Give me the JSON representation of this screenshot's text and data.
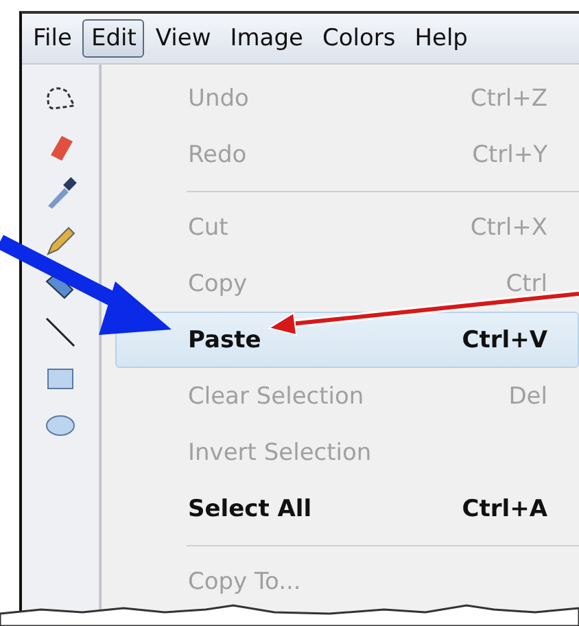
{
  "menu_bar": [
    {
      "label": "File",
      "selected": false
    },
    {
      "label": "Edit",
      "selected": true
    },
    {
      "label": "View",
      "selected": false
    },
    {
      "label": "Image",
      "selected": false
    },
    {
      "label": "Colors",
      "selected": false
    },
    {
      "label": "Help",
      "selected": false
    }
  ],
  "tools": [
    {
      "kind": "lasso"
    },
    {
      "kind": "eraser"
    },
    {
      "kind": "picker"
    },
    {
      "kind": "pencil"
    },
    {
      "kind": "fill"
    },
    {
      "kind": "line"
    },
    {
      "kind": "rect"
    },
    {
      "kind": "ellipse"
    }
  ],
  "edit_menu": [
    {
      "kind": "item",
      "label": "Undo",
      "shortcut": "Ctrl+Z",
      "disabled": true,
      "highlighted": false
    },
    {
      "kind": "item",
      "label": "Redo",
      "shortcut": "Ctrl+Y",
      "disabled": true,
      "highlighted": false
    },
    {
      "kind": "separator"
    },
    {
      "kind": "item",
      "label": "Cut",
      "shortcut": "Ctrl+X",
      "disabled": true,
      "highlighted": false
    },
    {
      "kind": "item",
      "label": "Copy",
      "shortcut": "Ctrl",
      "disabled": true,
      "highlighted": false
    },
    {
      "kind": "item",
      "label": "Paste",
      "shortcut": "Ctrl+V",
      "disabled": false,
      "highlighted": true
    },
    {
      "kind": "item",
      "label": "Clear Selection",
      "shortcut": "Del",
      "disabled": true,
      "highlighted": false
    },
    {
      "kind": "item",
      "label": "Invert Selection",
      "disabled": true,
      "highlighted": false
    },
    {
      "kind": "item",
      "label": "Select All",
      "shortcut": "Ctrl+A",
      "disabled": false,
      "highlighted": false
    },
    {
      "kind": "separator"
    },
    {
      "kind": "item",
      "label": "Copy To...",
      "disabled": true,
      "highlighted": false
    }
  ]
}
